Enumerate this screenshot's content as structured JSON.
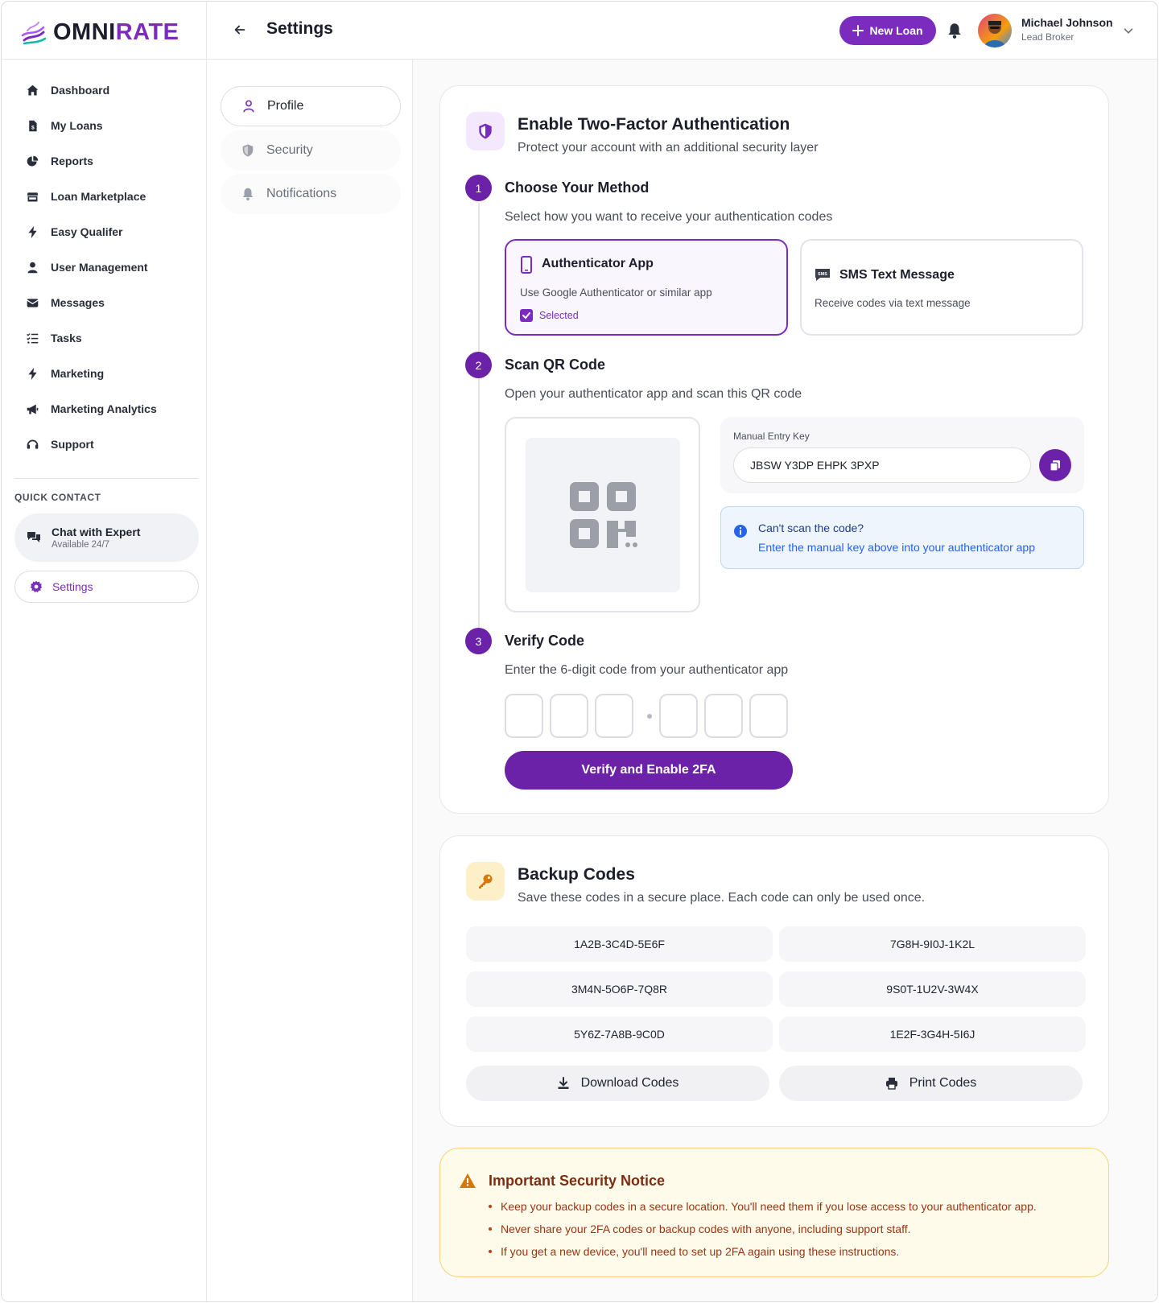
{
  "brand": {
    "name_part1": "OMNI",
    "name_part2": "RATE",
    "accent": "#7b2cbf"
  },
  "sidebar": {
    "items": [
      {
        "label": "Dashboard",
        "icon": "home-icon"
      },
      {
        "label": "My Loans",
        "icon": "document-dollar-icon"
      },
      {
        "label": "Reports",
        "icon": "pie-chart-icon"
      },
      {
        "label": "Loan Marketplace",
        "icon": "store-icon"
      },
      {
        "label": "Easy Qualifer",
        "icon": "bolt-icon"
      },
      {
        "label": "User Management",
        "icon": "user-icon"
      },
      {
        "label": "Messages",
        "icon": "envelope-icon"
      },
      {
        "label": "Tasks",
        "icon": "list-check-icon"
      },
      {
        "label": "Marketing",
        "icon": "bolt-icon"
      },
      {
        "label": "Marketing Analytics",
        "icon": "megaphone-icon"
      },
      {
        "label": "Support",
        "icon": "headset-icon"
      }
    ],
    "quick_contact_label": "QUICK CONTACT",
    "chat": {
      "title": "Chat with Expert",
      "subtitle": "Available 24/7"
    },
    "settings_label": "Settings"
  },
  "header": {
    "title": "Settings",
    "new_loan_label": "New Loan",
    "user_name": "Michael Johnson",
    "user_role": "Lead Broker"
  },
  "subnav": {
    "profile": "Profile",
    "security": "Security",
    "notifications": "Notifications"
  },
  "twofa": {
    "title": "Enable Two-Factor Authentication",
    "subtitle": "Protect your account with an additional security layer",
    "step1": {
      "num": "1",
      "title": "Choose Your Method",
      "desc": "Select how you want to receive your authentication codes",
      "app_title": "Authenticator App",
      "app_desc": "Use Google Authenticator or similar app",
      "selected_label": "Selected",
      "sms_title": "SMS Text Message",
      "sms_desc": "Receive codes via text message"
    },
    "step2": {
      "num": "2",
      "title": "Scan QR Code",
      "desc": "Open your authenticator app and scan this QR code",
      "manual_label": "Manual Entry Key",
      "manual_key": "JBSW Y3DP EHPK 3PXP",
      "cant_scan_title": "Can't scan the code?",
      "cant_scan_desc": "Enter the manual key above into your authenticator app"
    },
    "step3": {
      "num": "3",
      "title": "Verify Code",
      "desc": "Enter the 6-digit code from your authenticator app",
      "verify_label": "Verify and Enable 2FA"
    }
  },
  "backup": {
    "title": "Backup Codes",
    "subtitle": "Save these codes in a secure place. Each code can only be used once.",
    "codes": [
      "1A2B-3C4D-5E6F",
      "7G8H-9I0J-1K2L",
      "3M4N-5O6P-7Q8R",
      "9S0T-1U2V-3W4X",
      "5Y6Z-7A8B-9C0D",
      "1E2F-3G4H-5I6J"
    ],
    "download_label": "Download Codes",
    "print_label": "Print Codes"
  },
  "notice": {
    "title": "Important Security Notice",
    "items": [
      "Keep your backup codes in a secure location. You'll need them if you lose access to your authenticator app.",
      "Never share your 2FA codes or backup codes with anyone, including support staff.",
      "If you get a new device, you'll need to set up 2FA again using these instructions."
    ]
  }
}
